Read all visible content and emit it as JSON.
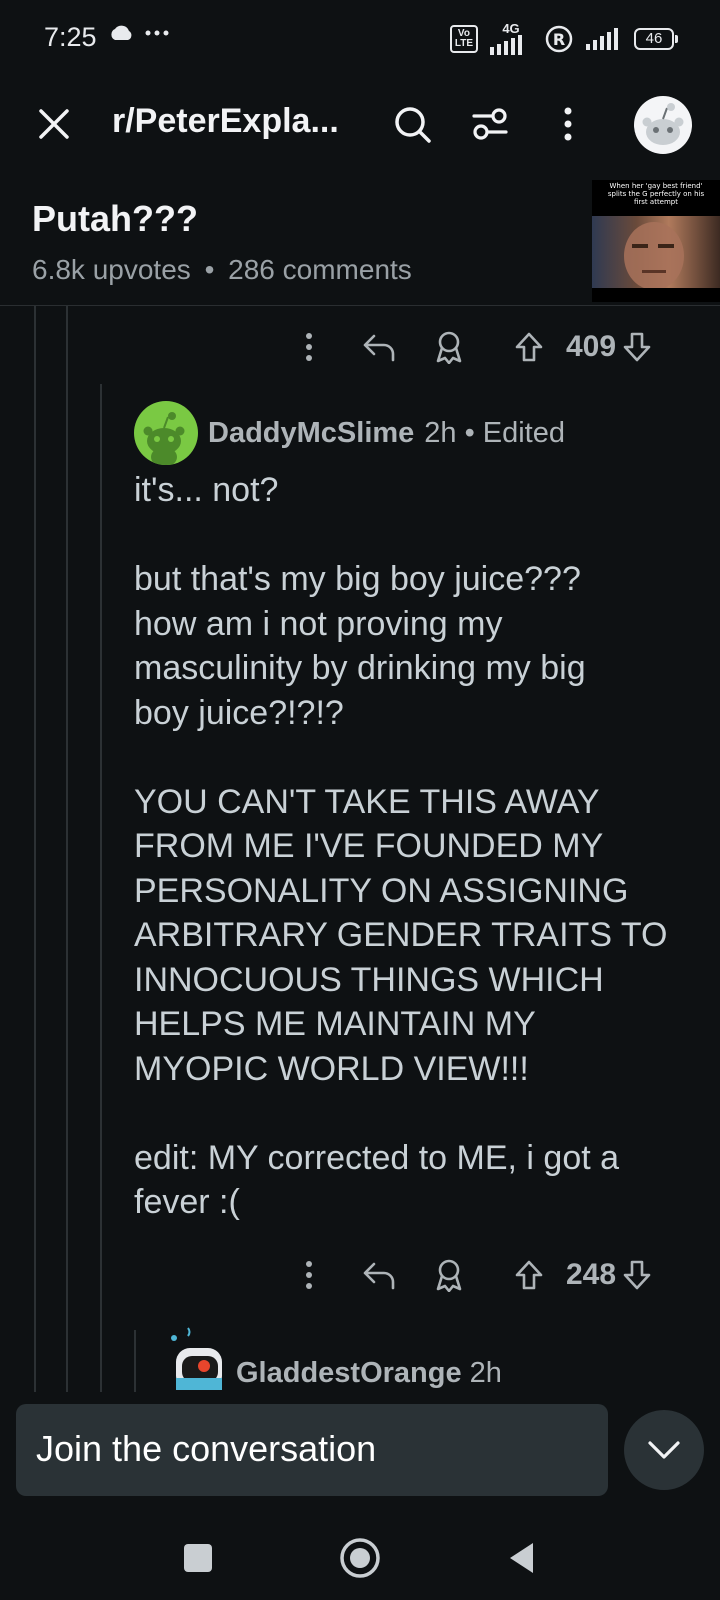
{
  "status_bar": {
    "time": "7:25",
    "network_label": "4G",
    "volte_label": "Vo\nLTE",
    "roaming_label": "R",
    "battery": "46"
  },
  "app_bar": {
    "subreddit": "r/PeterExpla...",
    "icons": [
      "close-icon",
      "search-icon",
      "filter-icon",
      "more-icon",
      "avatar"
    ]
  },
  "post": {
    "title": "Putah???",
    "upvotes": "6.8k upvotes",
    "separator": "•",
    "comments": "286 comments",
    "thumbnail_caption": "When her 'gay best friend' splits the G perfectly on his first attempt"
  },
  "parent_actions": {
    "score": "409"
  },
  "comment": {
    "author": "DaddyMcSlime",
    "age": "2h",
    "edited": "• Edited",
    "body": "it's... not?\n\nbut that's my big boy juice???\nhow am i not proving my\nmasculinity by drinking my big\nboy juice?!?!?\n\nYOU CAN'T TAKE THIS AWAY\nFROM ME I'VE FOUNDED MY\nPERSONALITY ON ASSIGNING\nARBITRARY GENDER TRAITS TO\nINNOCUOUS THINGS WHICH\nHELPS ME MAINTAIN MY\nMYOPIC WORLD VIEW!!!\n\nedit: MY corrected to ME, i got a\nfever :(",
    "score": "248"
  },
  "reply": {
    "author": "GladdestOrange",
    "age": "2h"
  },
  "composer": {
    "placeholder": "Join the conversation"
  },
  "colors": {
    "background": "#0e1113",
    "composer": "#2a3236",
    "avatar_green": "#7ac943"
  }
}
